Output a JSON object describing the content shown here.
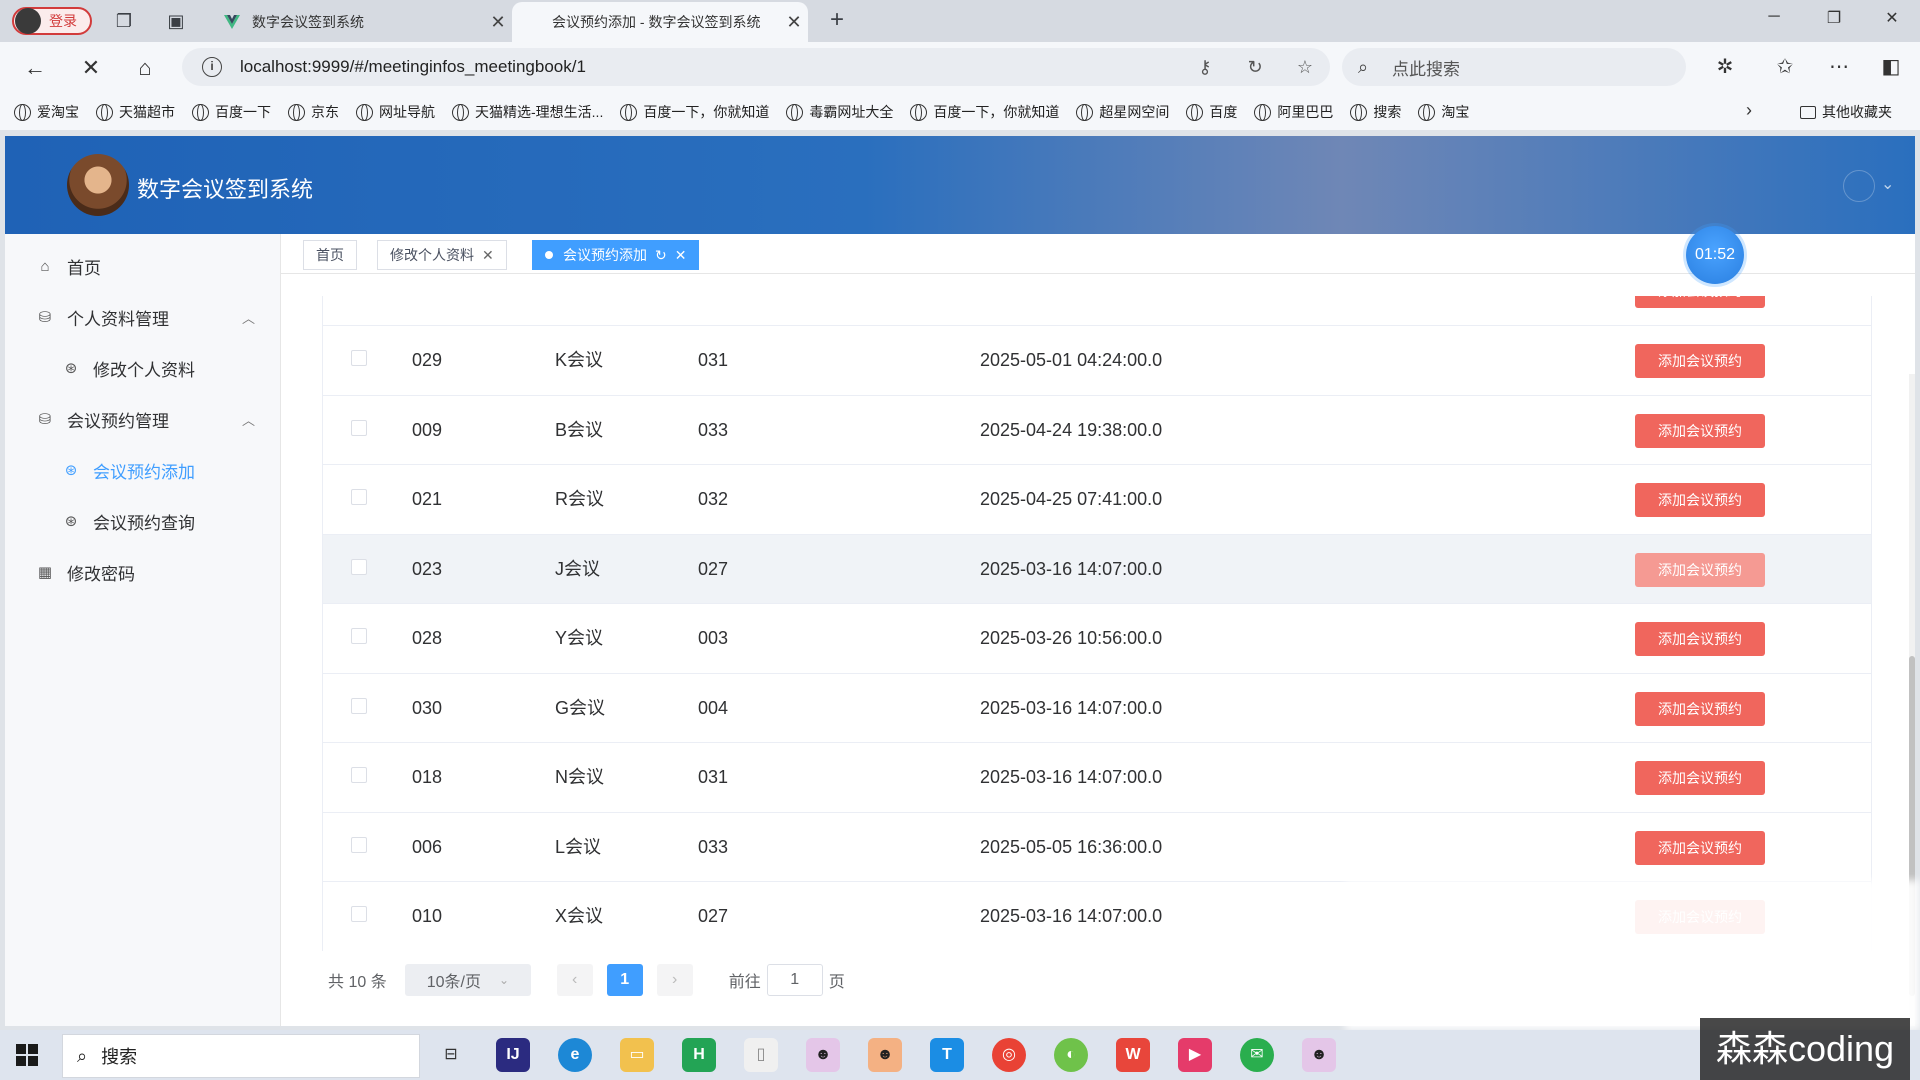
{
  "browser": {
    "profile_label": "登录",
    "tabs": [
      {
        "title": "数字会议签到系统",
        "active": false
      },
      {
        "title": "会议预约添加 - 数字会议签到系统",
        "active": true
      }
    ],
    "new_tab_symbol": "+",
    "url": "localhost:9999/#/meetinginfos_meetingbook/1",
    "search_placeholder": "点此搜索",
    "bookmarks": [
      "爱淘宝",
      "天猫超市",
      "百度一下",
      "京东",
      "网址导航",
      "天猫精选-理想生活...",
      "百度一下，你就知道",
      "毒霸网址大全",
      "百度一下，你就知道",
      "超星网空间",
      "百度",
      "阿里巴巴",
      "搜索",
      "淘宝"
    ],
    "other_bookmarks": "其他收藏夹"
  },
  "app": {
    "title": "数字会议签到系统",
    "sidebar": {
      "home": "首页",
      "profile_group": "个人资料管理",
      "profile_edit": "修改个人资料",
      "booking_group": "会议预约管理",
      "booking_add": "会议预约添加",
      "booking_query": "会议预约查询",
      "password": "修改密码"
    },
    "tags": [
      "首页",
      "修改个人资料",
      "会议预约添加"
    ],
    "timer": "01:52",
    "table": {
      "action_label": "添加会议预约",
      "rows": [
        {
          "id": "029",
          "name": "K会议",
          "room": "031",
          "time": "2025-05-01 04:24:00.0"
        },
        {
          "id": "009",
          "name": "B会议",
          "room": "033",
          "time": "2025-04-24 19:38:00.0"
        },
        {
          "id": "021",
          "name": "R会议",
          "room": "032",
          "time": "2025-04-25 07:41:00.0"
        },
        {
          "id": "023",
          "name": "J会议",
          "room": "027",
          "time": "2025-03-16 14:07:00.0"
        },
        {
          "id": "028",
          "name": "Y会议",
          "room": "003",
          "time": "2025-03-26 10:56:00.0"
        },
        {
          "id": "030",
          "name": "G会议",
          "room": "004",
          "time": "2025-03-16 14:07:00.0"
        },
        {
          "id": "018",
          "name": "N会议",
          "room": "031",
          "time": "2025-03-16 14:07:00.0"
        },
        {
          "id": "006",
          "name": "L会议",
          "room": "033",
          "time": "2025-05-05 16:36:00.0"
        },
        {
          "id": "010",
          "name": "X会议",
          "room": "027",
          "time": "2025-03-16 14:07:00.0"
        }
      ]
    },
    "pagination": {
      "total": "共 10 条",
      "page_size": "10条/页",
      "current_page": "1",
      "goto_label": "前往",
      "goto_value": "1",
      "goto_unit": "页"
    }
  },
  "taskbar": {
    "search_label": "搜索",
    "watermark": "森森coding"
  }
}
